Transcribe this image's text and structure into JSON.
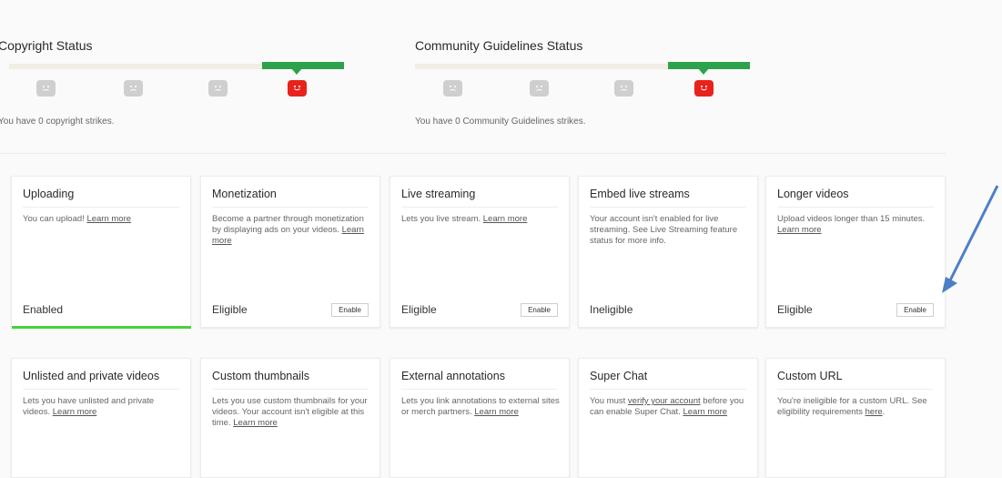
{
  "copyright": {
    "title": "Copyright Status",
    "note": "You have 0 copyright strikes.",
    "active_face_color": "#e8231d"
  },
  "community": {
    "title": "Community Guidelines Status",
    "note": "You have 0 Community Guidelines strikes.",
    "active_face_color": "#e8231d"
  },
  "features_row1": [
    {
      "title": "Uploading",
      "desc": "You can upload!",
      "link": "Learn more",
      "state": "Enabled",
      "button": ""
    },
    {
      "title": "Monetization",
      "desc": "Become a partner through monetization by displaying ads on your videos.",
      "link": "Learn more",
      "state": "Eligible",
      "button": "Enable"
    },
    {
      "title": "Live streaming",
      "desc": "Lets you live stream.",
      "link": "Learn more",
      "state": "Eligible",
      "button": "Enable"
    },
    {
      "title": "Embed live streams",
      "desc": "Your account isn't enabled for live streaming. See Live Streaming feature status for more info.",
      "link": "",
      "state": "Ineligible",
      "button": ""
    },
    {
      "title": "Longer videos",
      "desc": "Upload videos longer than 15 minutes.",
      "link": "Learn more",
      "state": "Eligible",
      "button": "Enable"
    }
  ],
  "features_row2": [
    {
      "title": "Unlisted and private videos",
      "desc_pre": "Lets you have unlisted and private videos.",
      "link": "Learn more",
      "desc_post": ""
    },
    {
      "title": "Custom thumbnails",
      "desc_pre": "Lets you use custom thumbnails for your videos. Your account isn't eligible at this time.",
      "link": "Learn more",
      "desc_post": ""
    },
    {
      "title": "External annotations",
      "desc_pre": "Lets you link annotations to external sites or merch partners.",
      "link": "Learn more",
      "desc_post": ""
    },
    {
      "title": "Super Chat",
      "desc_pre": "You must",
      "link": "verify your account",
      "desc_post": "before you can enable Super Chat.",
      "link2": "Learn more"
    },
    {
      "title": "Custom URL",
      "desc_pre": "You're ineligible for a custom URL. See eligibility requirements",
      "link": "here",
      "desc_post": "."
    }
  ],
  "colors": {
    "status_green": "#2ea24a",
    "enabled_bar": "#47d23a",
    "arrow_blue": "#4d7fc7"
  },
  "icons": {
    "status_face": "face-icon",
    "annotation_arrow": "arrow-icon"
  }
}
